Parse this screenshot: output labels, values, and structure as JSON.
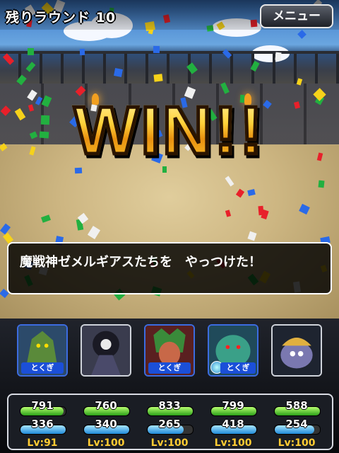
{
  "header": {
    "round_label": "残りラウンド 10",
    "menu_label": "メニュー"
  },
  "banner": {
    "text": "WIN!!"
  },
  "message": {
    "text": "魔戦神ゼメルギアスたちを　やっつけた！"
  },
  "party": [
    {
      "name": "party-member-1",
      "tag": "とくぎ",
      "special": true,
      "gem": false,
      "hp": 791,
      "mp": 336,
      "hp_fill": 0.95,
      "mp_fill": 1.0,
      "level": "Lv:91"
    },
    {
      "name": "party-member-2",
      "tag": "",
      "special": false,
      "gem": false,
      "hp": 760,
      "mp": 340,
      "hp_fill": 1.0,
      "mp_fill": 1.0,
      "level": "Lv:100"
    },
    {
      "name": "party-member-3",
      "tag": "とくぎ",
      "special": true,
      "gem": false,
      "hp": 833,
      "mp": 265,
      "hp_fill": 1.0,
      "mp_fill": 0.8,
      "level": "Lv:100"
    },
    {
      "name": "party-member-4",
      "tag": "とくぎ",
      "special": true,
      "gem": true,
      "hp": 799,
      "mp": 418,
      "hp_fill": 1.0,
      "mp_fill": 1.0,
      "level": "Lv:100"
    },
    {
      "name": "party-member-5",
      "tag": "",
      "special": false,
      "gem": false,
      "hp": 588,
      "mp": 254,
      "hp_fill": 1.0,
      "mp_fill": 0.88,
      "level": "Lv:100"
    }
  ],
  "colors": {
    "win_gold": "#ffc51a",
    "hp_green": "#2aa018",
    "mp_blue": "#1f8ad8",
    "level_gold": "#ffcc33",
    "tag_blue": "#1b4fd8"
  }
}
